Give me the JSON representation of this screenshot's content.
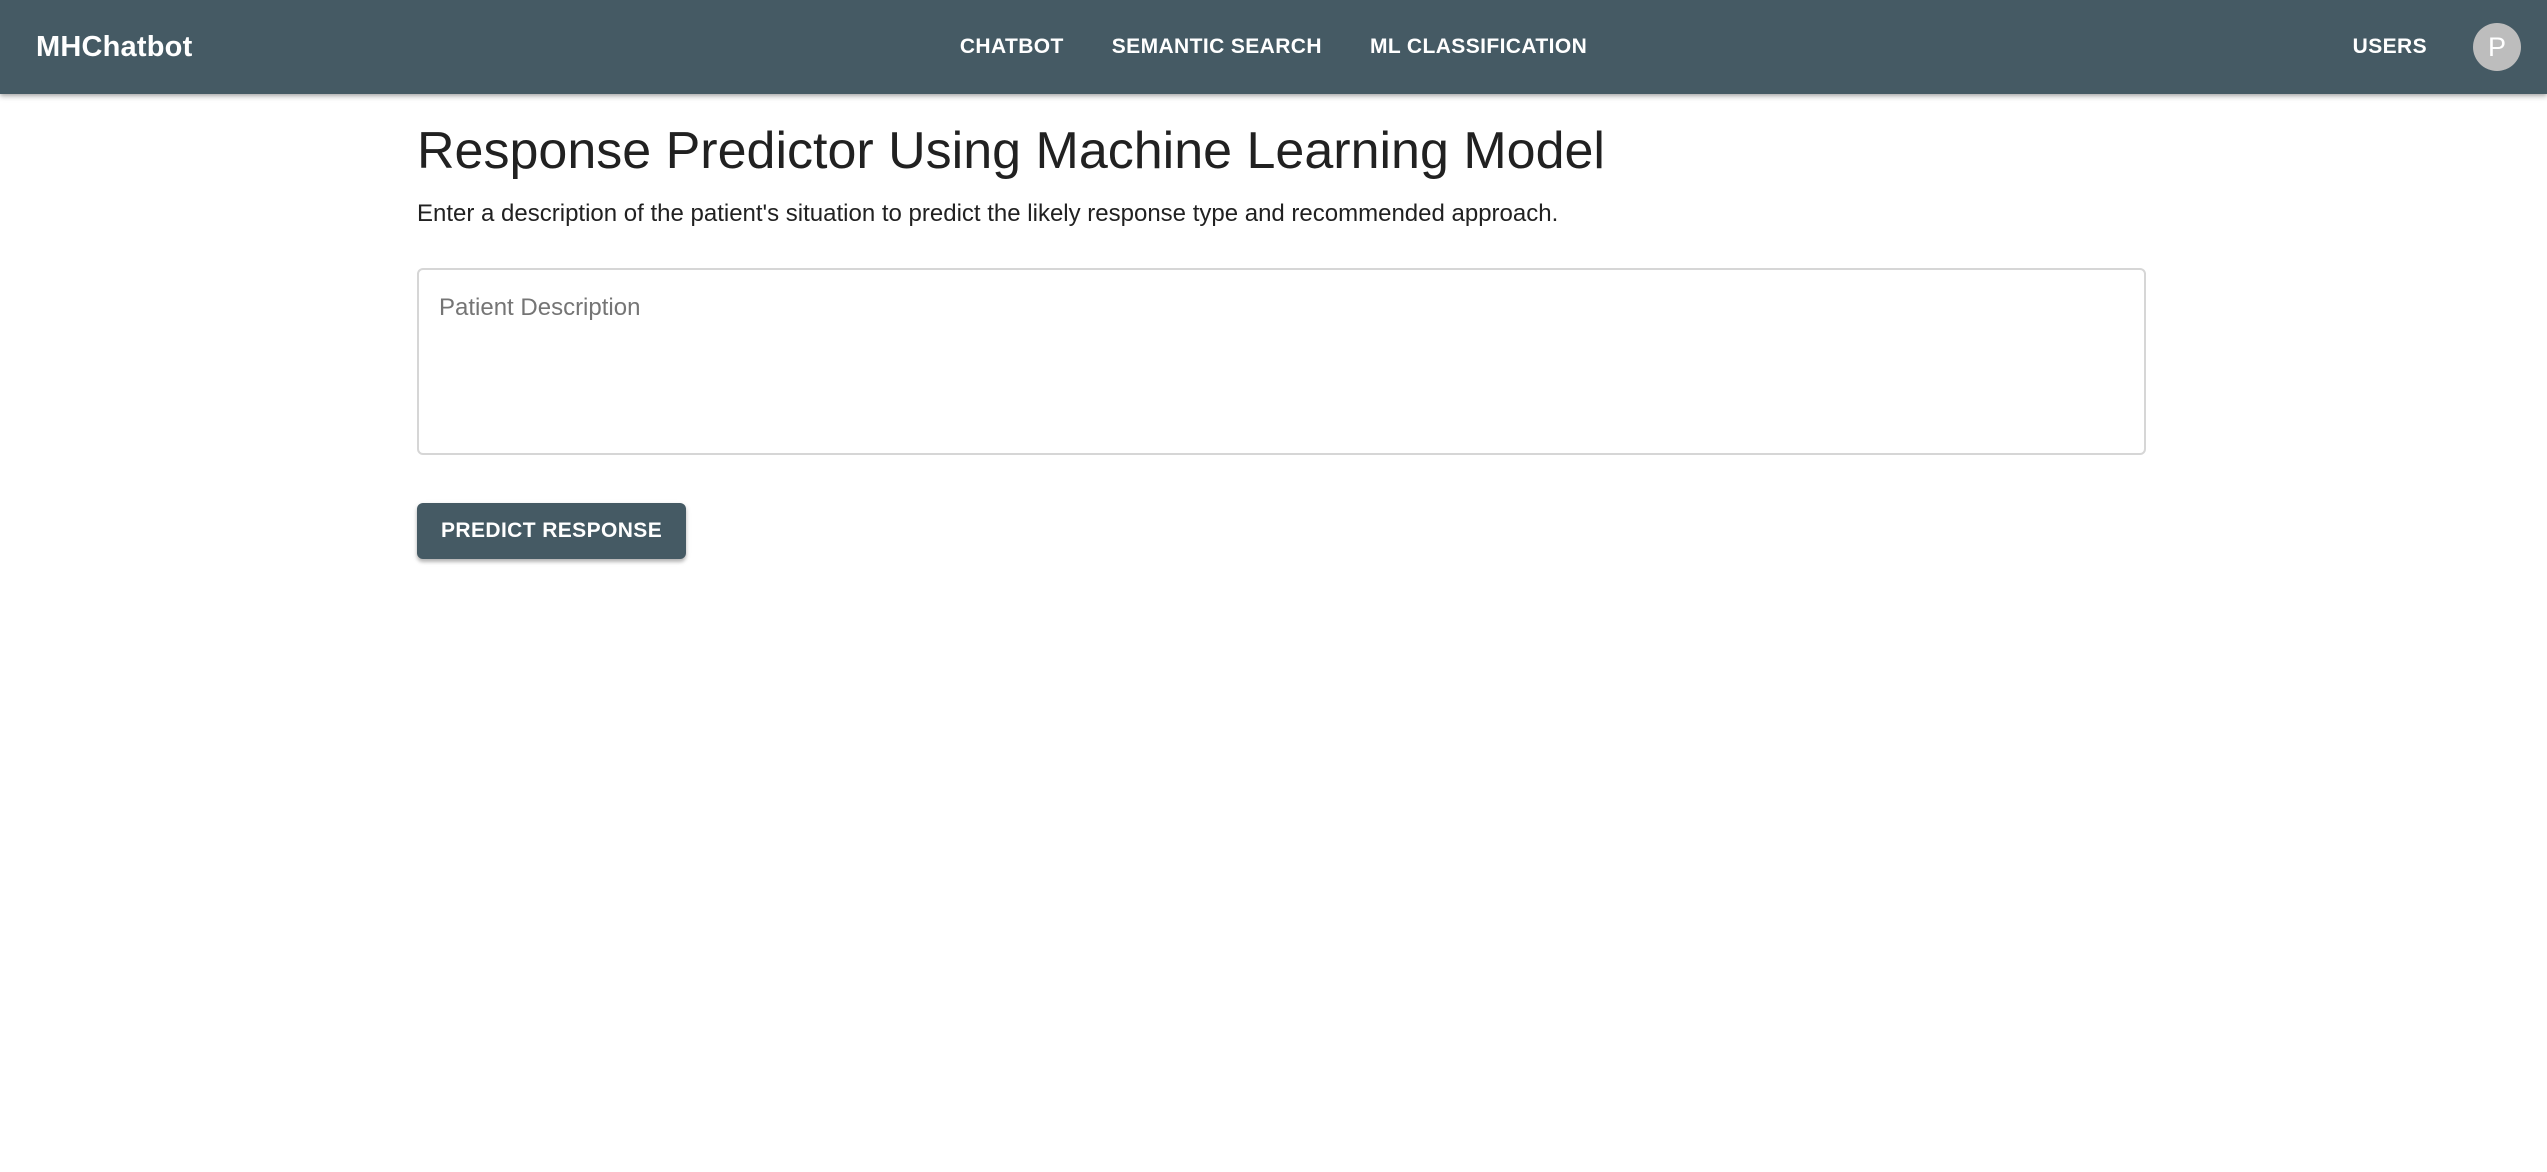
{
  "header": {
    "brand": "MHChatbot",
    "nav": [
      {
        "label": "CHATBOT"
      },
      {
        "label": "SEMANTIC SEARCH"
      },
      {
        "label": "ML CLASSIFICATION"
      }
    ],
    "users_label": "USERS",
    "avatar_initial": "P"
  },
  "main": {
    "title": "Response Predictor Using Machine Learning Model",
    "subtitle": "Enter a description of the patient's situation to predict the likely response type and recommended approach.",
    "description_field": {
      "placeholder": "Patient Description",
      "value": ""
    },
    "predict_button_label": "PREDICT RESPONSE"
  },
  "colors": {
    "appbar": "#455a64",
    "avatar": "#bdbdbd",
    "text": "#212121"
  }
}
